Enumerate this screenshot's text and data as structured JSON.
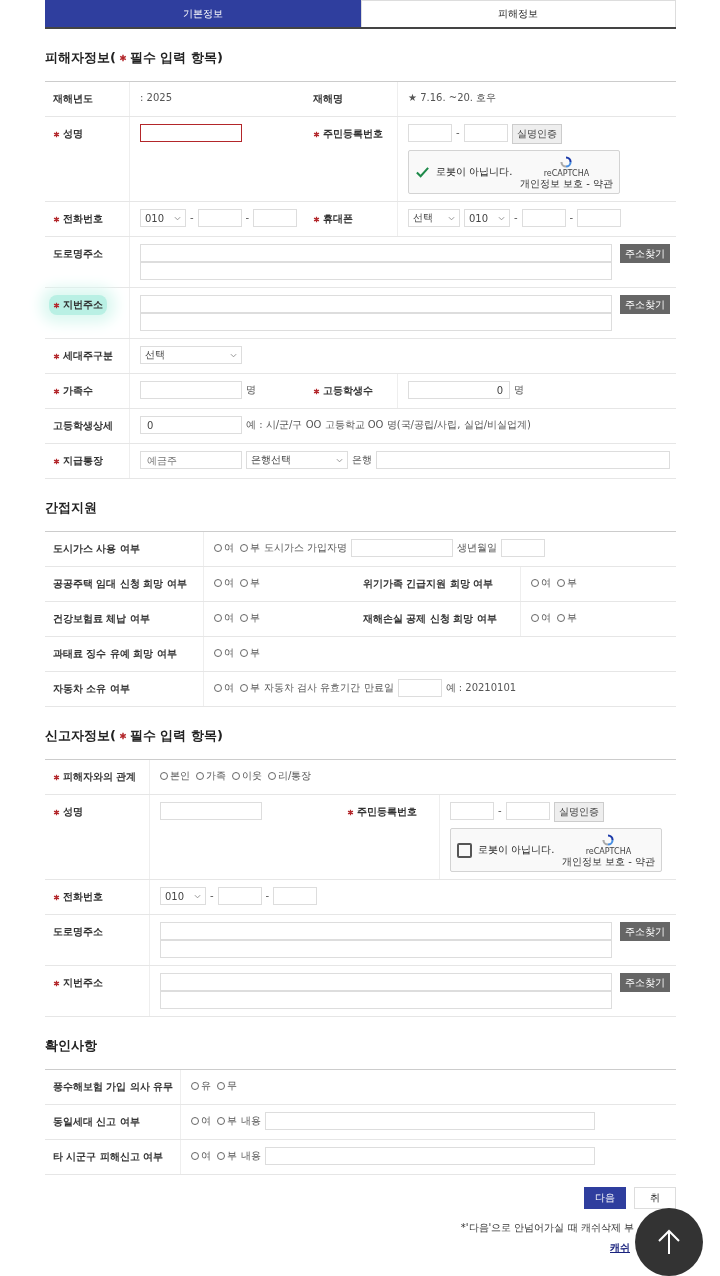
{
  "tabs": [
    {
      "label": "기본정보",
      "selected": true
    },
    {
      "label": "피해정보",
      "selected": false
    }
  ],
  "sections": [
    {
      "title": "피해자정보(",
      "required_mark": true,
      "title_rest": "필수 입력 항목)",
      "rows": [
        {
          "cells": [
            {
              "label": "재해년도",
              "required": false,
              "controls": [
                {
                  "kind": "text",
                  "text": ": 2025"
                }
              ]
            },
            {
              "label": "재해명",
              "required": false,
              "controls": [
                {
                  "kind": "text",
                  "text": "★ 7.16. ~20. 호우"
                }
              ]
            }
          ]
        },
        {
          "cells": [
            {
              "label": "성명",
              "required": true,
              "controls": [
                {
                  "kind": "input",
                  "invalid": true
                }
              ]
            },
            {
              "label": "주민등록번호",
              "required": true,
              "controls": [
                {
                  "kind": "short_input"
                },
                {
                  "kind": "text",
                  "text": "-"
                },
                {
                  "kind": "short_input"
                },
                {
                  "kind": "button",
                  "text": "실명인증"
                },
                {
                  "kind": "captcha",
                  "checked": true,
                  "text": "로봇이 아닙니다.",
                  "brand": "reCAPTCHA",
                  "terms": "개인정보 보호 - 약관"
                }
              ]
            }
          ]
        },
        {
          "cells": [
            {
              "label": "전화번호",
              "required": true,
              "controls": [
                {
                  "kind": "small_select",
                  "value": "010"
                },
                {
                  "kind": "text",
                  "text": "-"
                },
                {
                  "kind": "short_input"
                },
                {
                  "kind": "text",
                  "text": "-"
                },
                {
                  "kind": "short_input"
                }
              ]
            },
            {
              "label": "휴대폰",
              "required": true,
              "controls": [
                {
                  "kind": "select",
                  "value": "선택"
                },
                {
                  "kind": "small_select",
                  "value": "010"
                },
                {
                  "kind": "text",
                  "text": "-"
                },
                {
                  "kind": "short_input"
                },
                {
                  "kind": "text",
                  "text": "-"
                },
                {
                  "kind": "short_input"
                }
              ]
            }
          ]
        },
        {
          "cells": [
            {
              "label": "도로명주소",
              "required": false,
              "controls": [
                {
                  "kind": "address",
                  "button": "주소찾기"
                }
              ]
            }
          ]
        },
        {
          "cells": [
            {
              "label": "지번주소",
              "required": true,
              "highlighted": true,
              "controls": [
                {
                  "kind": "address",
                  "button": "주소찾기"
                }
              ]
            }
          ]
        },
        {
          "cells": [
            {
              "label": "세대주구분",
              "required": true,
              "controls": [
                {
                  "kind": "wide_select",
                  "value": "선택"
                }
              ]
            }
          ]
        },
        {
          "cells": [
            {
              "label": "가족수",
              "required": true,
              "controls": [
                {
                  "kind": "input"
                },
                {
                  "kind": "text",
                  "text": "명"
                }
              ]
            },
            {
              "label": "고등학생수",
              "required": true,
              "controls": [
                {
                  "kind": "number_input",
                  "value": "0"
                },
                {
                  "kind": "text",
                  "text": "명"
                }
              ]
            }
          ]
        },
        {
          "cells": [
            {
              "label": "고등학생상세",
              "required": false,
              "controls": [
                {
                  "kind": "input",
                  "value": "0"
                },
                {
                  "kind": "text",
                  "text": "예 : 시/군/구 OO 고등학교 OO 명(국/공립/사립, 실업/비실업계)"
                }
              ]
            }
          ]
        },
        {
          "cells": [
            {
              "label": "지급통장",
              "required": true,
              "controls": [
                {
                  "kind": "input",
                  "placeholder": "예금주"
                },
                {
                  "kind": "wide_select",
                  "value": "은행선택"
                },
                {
                  "kind": "text",
                  "text": "은행"
                },
                {
                  "kind": "long_input"
                }
              ]
            }
          ]
        }
      ]
    },
    {
      "title": "간접지원",
      "rows": [
        {
          "cells": [
            {
              "label": "도시가스 사용 여부",
              "required": false,
              "controls": [
                {
                  "kind": "radios",
                  "options": [
                    {
                      "label": "여",
                      "selected": false
                    },
                    {
                      "label": "부",
                      "selected": false
                    }
                  ]
                },
                {
                  "kind": "text",
                  "text": "도시가스 가입자명"
                },
                {
                  "kind": "input"
                },
                {
                  "kind": "text",
                  "text": "생년월일"
                },
                {
                  "kind": "short_input"
                }
              ]
            }
          ]
        },
        {
          "cells": [
            {
              "label": "공공주택 임대 신청 희망 여부",
              "required": false,
              "controls": [
                {
                  "kind": "radios",
                  "options": [
                    {
                      "label": "여",
                      "selected": false
                    },
                    {
                      "label": "부",
                      "selected": false
                    }
                  ]
                }
              ]
            },
            {
              "label": "위기가족 긴급지원 희망 여부",
              "required": false,
              "controls": [
                {
                  "kind": "radios",
                  "options": [
                    {
                      "label": "여",
                      "selected": false
                    },
                    {
                      "label": "부",
                      "selected": false
                    }
                  ]
                }
              ]
            }
          ]
        },
        {
          "cells": [
            {
              "label": "건강보험료 체납 여부",
              "required": false,
              "controls": [
                {
                  "kind": "radios",
                  "options": [
                    {
                      "label": "여",
                      "selected": false
                    },
                    {
                      "label": "부",
                      "selected": false
                    }
                  ]
                }
              ]
            },
            {
              "label": "재해손실 공제 신청 희망 여부",
              "required": false,
              "controls": [
                {
                  "kind": "radios",
                  "options": [
                    {
                      "label": "여",
                      "selected": false
                    },
                    {
                      "label": "부",
                      "selected": false
                    }
                  ]
                }
              ]
            }
          ]
        },
        {
          "cells": [
            {
              "label": "과태료 징수 유예 희망 여부",
              "required": false,
              "controls": [
                {
                  "kind": "radios",
                  "options": [
                    {
                      "label": "여",
                      "selected": false
                    },
                    {
                      "label": "부",
                      "selected": false
                    }
                  ]
                }
              ]
            }
          ]
        },
        {
          "cells": [
            {
              "label": "자동차 소유 여부",
              "required": false,
              "controls": [
                {
                  "kind": "radios",
                  "options": [
                    {
                      "label": "여",
                      "selected": false
                    },
                    {
                      "label": "부",
                      "selected": false
                    }
                  ]
                },
                {
                  "kind": "text",
                  "text": "자동차 검사 유효기간 만료일"
                },
                {
                  "kind": "short_input"
                },
                {
                  "kind": "text",
                  "text": "예 : 20210101"
                }
              ]
            }
          ]
        }
      ]
    },
    {
      "title": "신고자정보(",
      "required_mark": true,
      "title_rest": "필수 입력 항목)",
      "rows": [
        {
          "cells": [
            {
              "label": "피해자와의 관계",
              "required": true,
              "controls": [
                {
                  "kind": "radios",
                  "options": [
                    {
                      "label": "본인",
                      "selected": false
                    },
                    {
                      "label": "가족",
                      "selected": false
                    },
                    {
                      "label": "이웃",
                      "selected": false
                    },
                    {
                      "label": "리/통장",
                      "selected": false
                    }
                  ]
                }
              ]
            }
          ]
        },
        {
          "cells": [
            {
              "label": "성명",
              "required": true,
              "controls": [
                {
                  "kind": "input"
                }
              ]
            },
            {
              "label": "주민등록번호",
              "required": true,
              "controls": [
                {
                  "kind": "short_input"
                },
                {
                  "kind": "text",
                  "text": "-"
                },
                {
                  "kind": "short_input"
                },
                {
                  "kind": "button",
                  "text": "실명인증"
                },
                {
                  "kind": "captcha",
                  "checked": false,
                  "text": "로봇이 아닙니다.",
                  "brand": "reCAPTCHA",
                  "terms": "개인정보 보호 - 약관"
                }
              ]
            }
          ]
        },
        {
          "cells": [
            {
              "label": "전화번호",
              "required": true,
              "controls": [
                {
                  "kind": "small_select",
                  "value": "010"
                },
                {
                  "kind": "text",
                  "text": "-"
                },
                {
                  "kind": "short_input"
                },
                {
                  "kind": "text",
                  "text": "-"
                },
                {
                  "kind": "short_input"
                }
              ]
            }
          ]
        },
        {
          "cells": [
            {
              "label": "도로명주소",
              "required": false,
              "controls": [
                {
                  "kind": "address",
                  "button": "주소찾기"
                }
              ]
            }
          ]
        },
        {
          "cells": [
            {
              "label": "지번주소",
              "required": true,
              "controls": [
                {
                  "kind": "address",
                  "button": "주소찾기"
                }
              ]
            }
          ]
        }
      ]
    },
    {
      "title": "확인사항",
      "rows": [
        {
          "cells": [
            {
              "label": "풍수해보험 가입 의사 유무",
              "required": false,
              "controls": [
                {
                  "kind": "radios",
                  "options": [
                    {
                      "label": "유",
                      "selected": false
                    },
                    {
                      "label": "무",
                      "selected": false
                    }
                  ]
                }
              ]
            }
          ]
        },
        {
          "cells": [
            {
              "label": "동일세대 신고 여부",
              "required": false,
              "controls": [
                {
                  "kind": "radios",
                  "options": [
                    {
                      "label": "여",
                      "selected": false
                    },
                    {
                      "label": "부",
                      "selected": false
                    }
                  ]
                },
                {
                  "kind": "text",
                  "text": "내용"
                },
                {
                  "kind": "long_input"
                }
              ]
            }
          ]
        },
        {
          "cells": [
            {
              "label": "타 시군구 피해신고 여부",
              "required": false,
              "controls": [
                {
                  "kind": "radios",
                  "options": [
                    {
                      "label": "여",
                      "selected": false
                    },
                    {
                      "label": "부",
                      "selected": false
                    }
                  ]
                },
                {
                  "kind": "text",
                  "text": "내용"
                },
                {
                  "kind": "long_input"
                }
              ]
            }
          ]
        }
      ]
    }
  ],
  "actions": [
    {
      "label": "다음",
      "primary": true
    },
    {
      "label": "취",
      "primary": false
    }
  ],
  "note": "*'다음'으로 안넘어가실 때 캐쉬삭제 부",
  "note_link": "캐쉬"
}
